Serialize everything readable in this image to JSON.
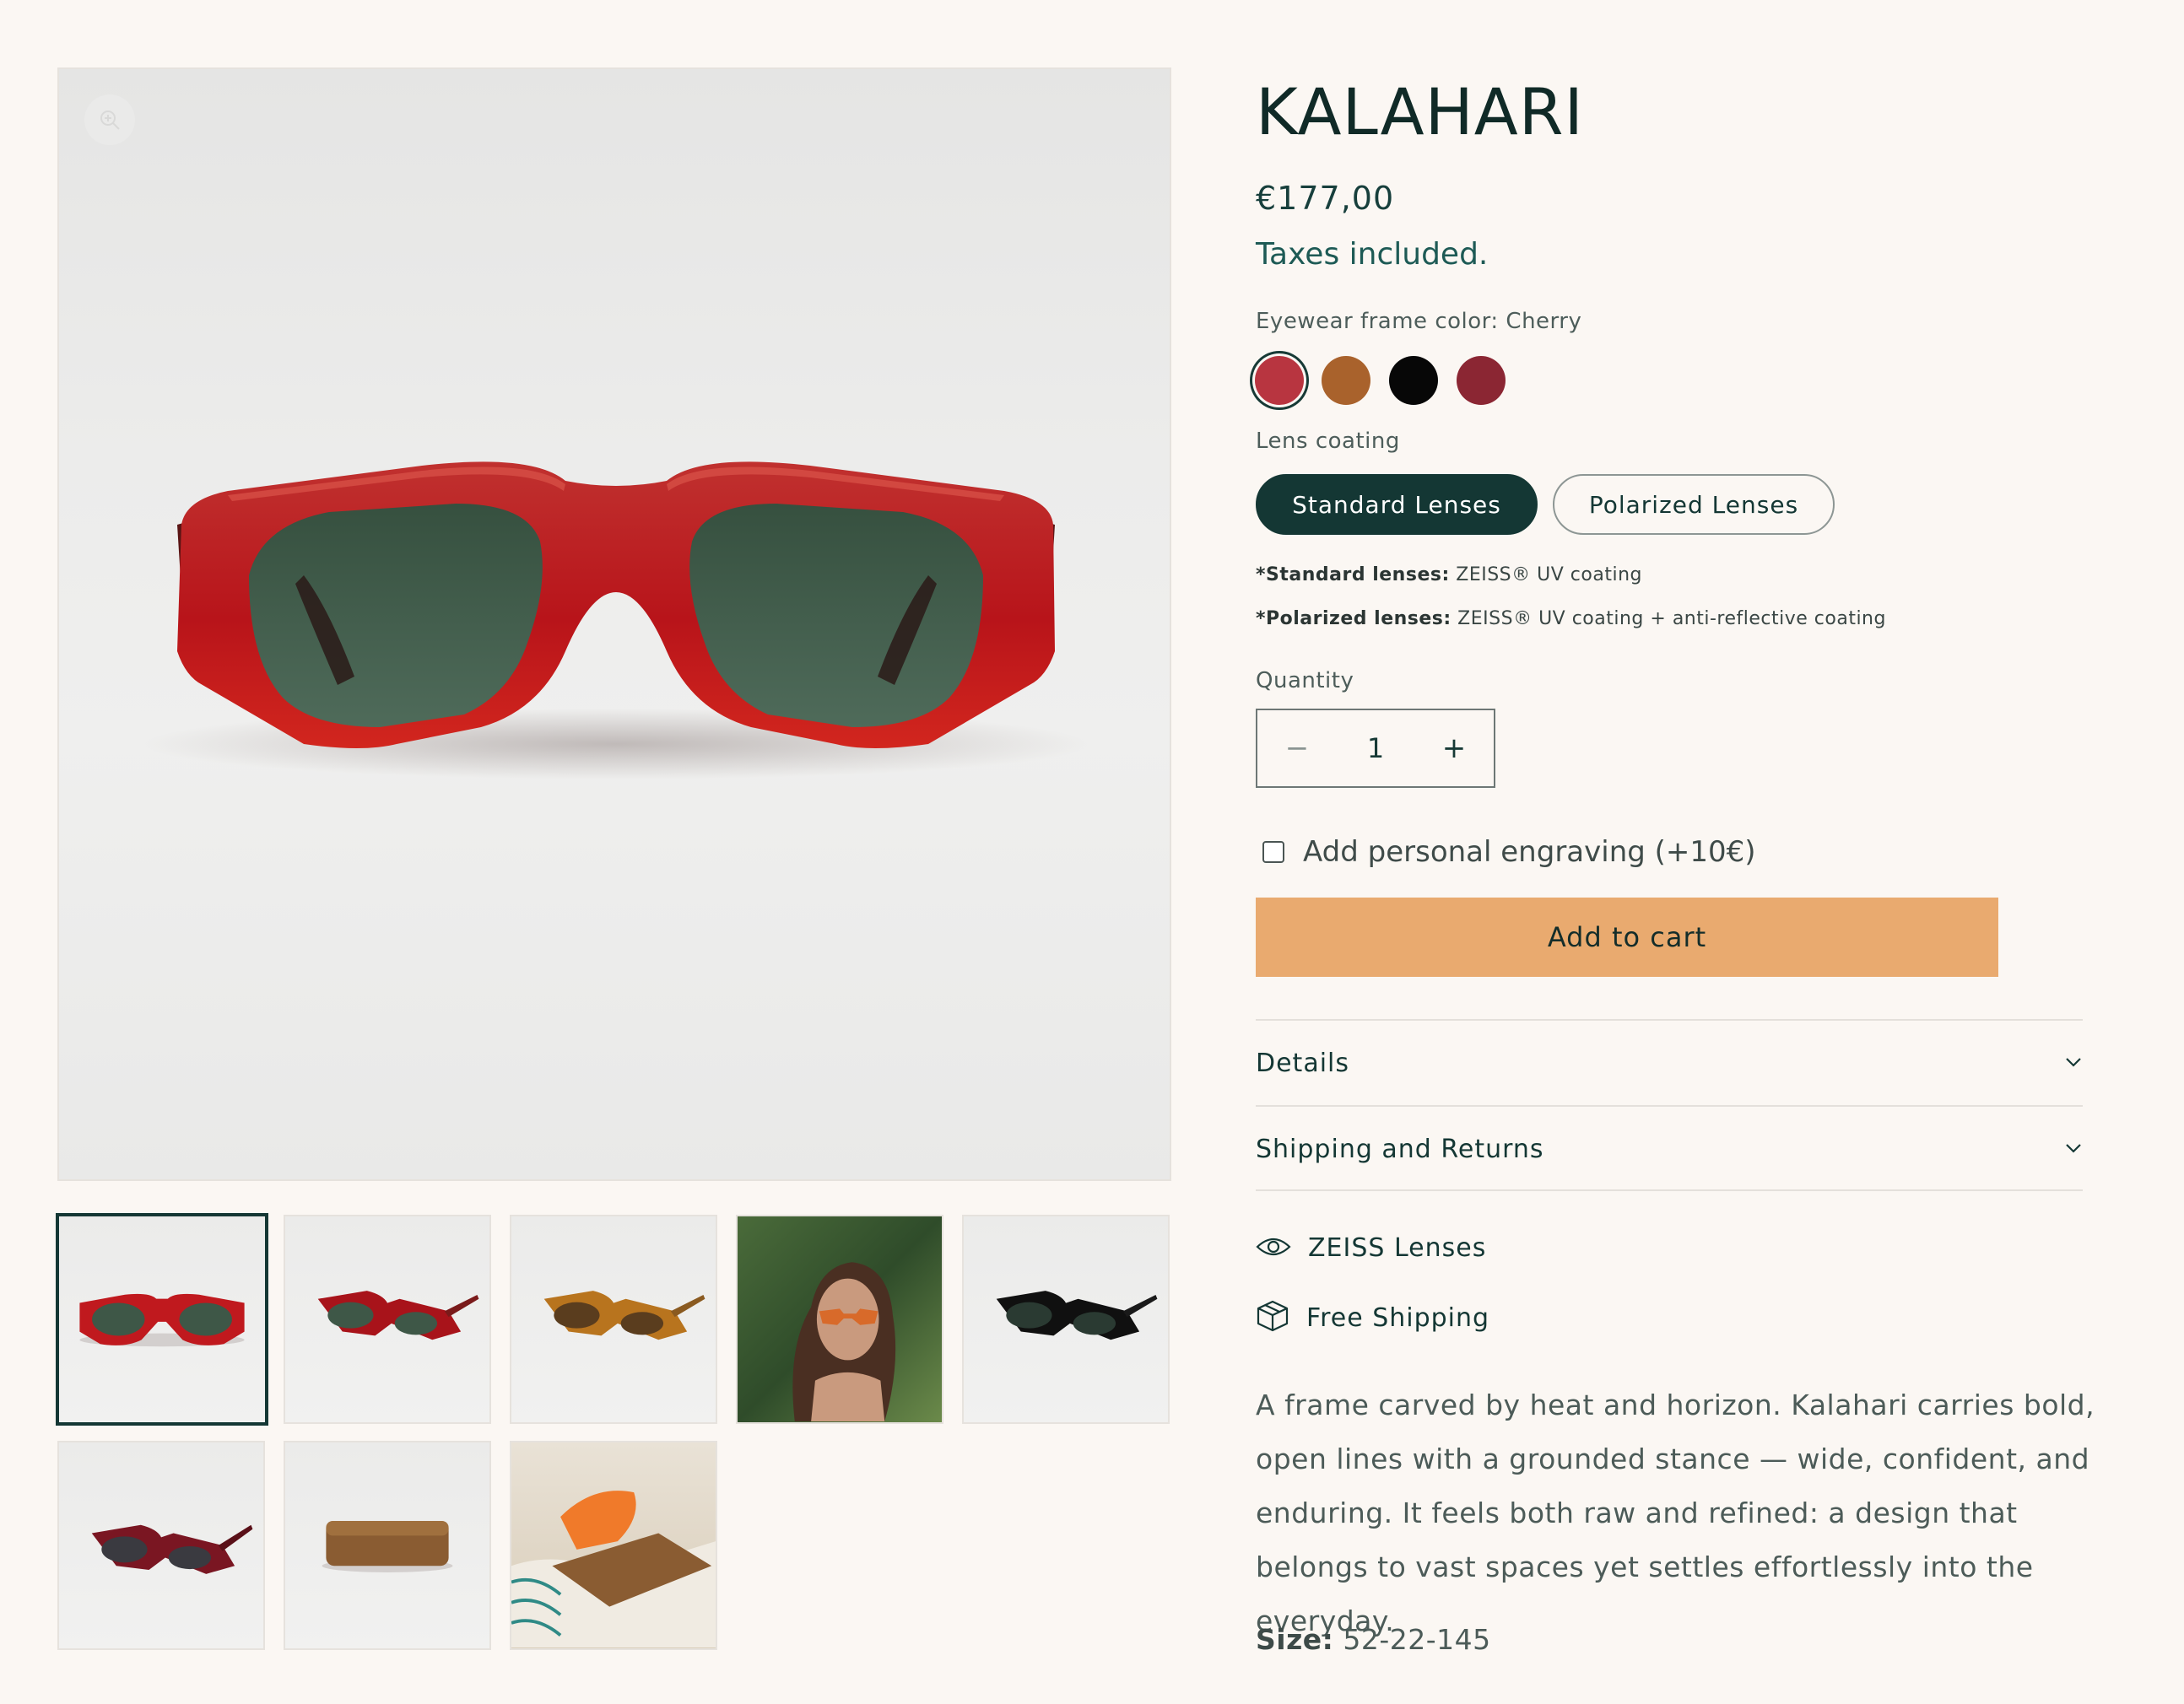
{
  "product": {
    "title": "KALAHARI",
    "price": "€177,00",
    "taxes_note": "Taxes included.",
    "color_option": {
      "label": "Eyewear frame color: Cherry",
      "swatches": [
        {
          "name": "Cherry",
          "hex": "#b83540",
          "selected": true
        },
        {
          "name": "Tortoise",
          "hex": "#a9622c",
          "selected": false
        },
        {
          "name": "Black",
          "hex": "#070707",
          "selected": false
        },
        {
          "name": "Burgundy",
          "hex": "#8b2633",
          "selected": false
        }
      ]
    },
    "lens_option": {
      "label": "Lens coating",
      "options": [
        "Standard Lenses",
        "Polarized Lenses"
      ],
      "selected": "Standard Lenses"
    },
    "notes": [
      {
        "strong": "*Standard lenses:",
        "text": " ZEISS® UV coating"
      },
      {
        "strong": "*Polarized lenses:",
        "text": " ZEISS® UV coating + anti-reflective coating"
      }
    ],
    "quantity": {
      "label": "Quantity",
      "value": "1",
      "minus": "−",
      "plus": "+"
    },
    "engraving": {
      "label": "Add personal engraving (+10€)",
      "checked": false
    },
    "add_to_cart": "Add to cart",
    "accordions": [
      "Details",
      "Shipping and Returns"
    ],
    "features": [
      {
        "icon": "eye-icon",
        "label": "ZEISS Lenses"
      },
      {
        "icon": "box-icon",
        "label": "Free Shipping"
      }
    ],
    "description": "A frame carved by heat and horizon. Kalahari carries bold, open lines with a grounded stance — wide, confident, and enduring. It feels both raw and refined: a design that belongs to vast spaces yet settles effortlessly into the everyday.",
    "size": {
      "label": "Size:",
      "value": "52-22-145"
    }
  },
  "gallery": {
    "main_image": "cherry-sunglasses-front",
    "thumbnails": [
      {
        "name": "cherry-front",
        "active": true
      },
      {
        "name": "cherry-angle",
        "active": false
      },
      {
        "name": "tortoise-angle",
        "active": false
      },
      {
        "name": "model-portrait",
        "active": false
      },
      {
        "name": "black-angle",
        "active": false
      },
      {
        "name": "burgundy-angle",
        "active": false
      },
      {
        "name": "case",
        "active": false
      },
      {
        "name": "case-and-cloth",
        "active": false
      }
    ]
  },
  "colors": {
    "background": "#fbf7f3",
    "primary": "#143734",
    "accent": "#e9aa6f",
    "frame_red": "#c2141c",
    "lens_green": "#3f5a4b"
  }
}
